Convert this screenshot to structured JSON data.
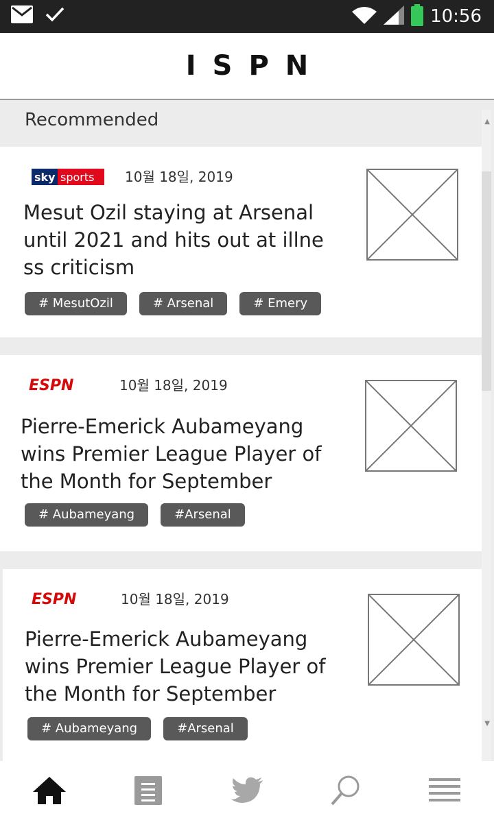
{
  "status_bar": {
    "time": "10:56"
  },
  "app": {
    "title": "ISPN"
  },
  "section": {
    "title": "Recommended"
  },
  "cards": [
    {
      "source": "sky sports",
      "date": "10월 18일, 2019",
      "title": "Mesut Ozil staying at Arsenal until 2021 and hits out at illness criticism",
      "tags": [
        "# MesutOzil",
        "# Arsenal",
        "# Emery"
      ]
    },
    {
      "source": "ESPN",
      "date": "10월 18일, 2019",
      "title": "Pierre-Emerick Aubameyang wins Premier League Player of the Month for September",
      "tags": [
        "# Aubameyang",
        "#Arsenal"
      ]
    },
    {
      "source": "ESPN",
      "date": "10월 18일, 2019",
      "title": "Pierre-Emerick Aubameyang wins Premier League Player of the Month for September",
      "tags": [
        "# Aubameyang",
        "#Arsenal"
      ]
    }
  ],
  "colors": {
    "status_bar": "#222222",
    "tag_bg": "#595959",
    "espn_red": "#d50a0a",
    "sky_red": "#e10a1d",
    "sky_blue": "#0a2a6a",
    "battery": "#35c759"
  },
  "nav": [
    "home-icon",
    "document-icon",
    "twitter-icon",
    "search-icon",
    "menu-icon"
  ]
}
